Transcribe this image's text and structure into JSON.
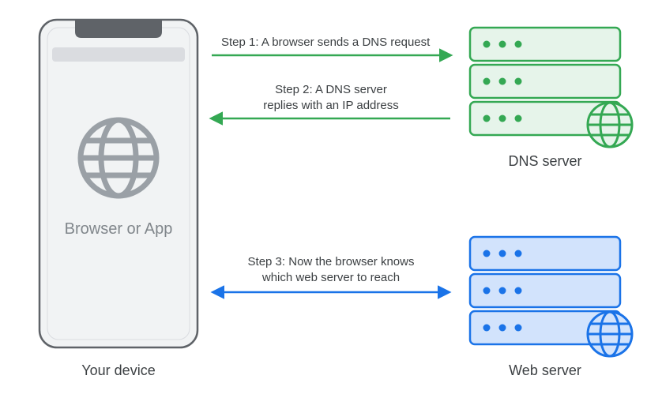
{
  "device": {
    "label": "Your device",
    "app_label": "Browser or App"
  },
  "dns_server": {
    "label": "DNS server"
  },
  "web_server": {
    "label": "Web server"
  },
  "steps": {
    "s1": "Step 1: A browser sends a DNS request",
    "s2a": "Step 2: A DNS server",
    "s2b": "replies with an IP address",
    "s3a": "Step 3: Now the browser knows",
    "s3b": "which web server to reach"
  },
  "colors": {
    "green": "#34a853",
    "green_fill": "#e6f4ea",
    "blue": "#1a73e8",
    "blue_fill": "#d2e3fc",
    "grey_stroke": "#5f6368",
    "grey_fill": "#f1f3f4",
    "grey_mid": "#9aa0a6",
    "grey_bar": "#dadce0"
  }
}
